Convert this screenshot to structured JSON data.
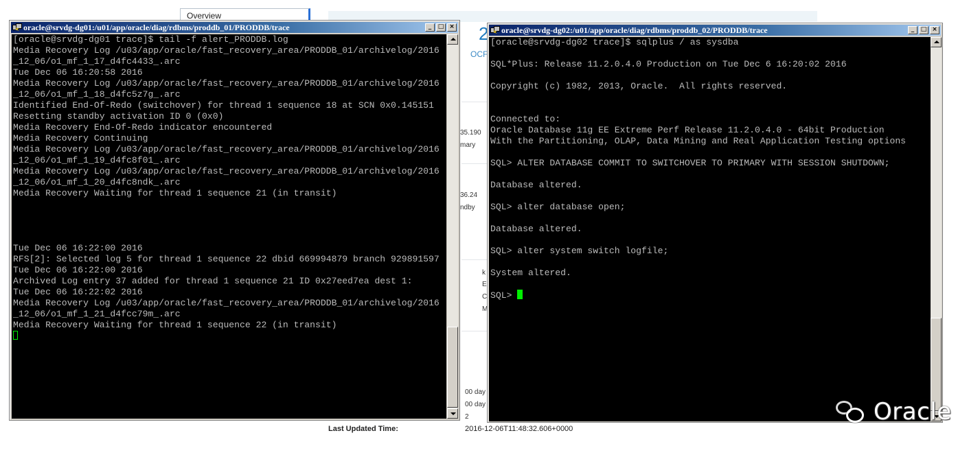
{
  "background": {
    "tab_label": "Overview",
    "big_number": "2",
    "ocp_label": "OCF",
    "fragments": [
      "35.190",
      "mary",
      "36.24",
      "ndby",
      "k",
      "E",
      "C",
      "M",
      "00 day",
      "00 day",
      "2"
    ],
    "last_updated_label": "Last Updated Time:",
    "last_updated_value": "2016-12-06T11:48:32.606+0000"
  },
  "window1": {
    "title": "oracle@srvdg-dg01:/u01/app/oracle/diag/rdbms/proddb_01/PRODDB/trace",
    "controls": [
      "_",
      "□",
      "×"
    ],
    "lines": [
      "[oracle@srvdg-dg01 trace]$ tail -f alert_PRODDB.log",
      "Media Recovery Log /u03/app/oracle/fast_recovery_area/PRODDB_01/archivelog/2016",
      "_12_06/o1_mf_1_17_d4fc4433_.arc",
      "Tue Dec 06 16:20:58 2016",
      "Media Recovery Log /u03/app/oracle/fast_recovery_area/PRODDB_01/archivelog/2016",
      "_12_06/o1_mf_1_18_d4fc5z7g_.arc",
      "Identified End-Of-Redo (switchover) for thread 1 sequence 18 at SCN 0x0.145151",
      "Resetting standby activation ID 0 (0x0)",
      "Media Recovery End-Of-Redo indicator encountered",
      "Media Recovery Continuing",
      "Media Recovery Log /u03/app/oracle/fast_recovery_area/PRODDB_01/archivelog/2016",
      "_12_06/o1_mf_1_19_d4fc8f01_.arc",
      "Media Recovery Log /u03/app/oracle/fast_recovery_area/PRODDB_01/archivelog/2016",
      "_12_06/o1_mf_1_20_d4fc8ndk_.arc",
      "Media Recovery Waiting for thread 1 sequence 21 (in transit)",
      "",
      "",
      "",
      "",
      "Tue Dec 06 16:22:00 2016",
      "RFS[2]: Selected log 5 for thread 1 sequence 22 dbid 669994879 branch 929891597",
      "Tue Dec 06 16:22:00 2016",
      "Archived Log entry 37 added for thread 1 sequence 21 ID 0x27eed7ea dest 1:",
      "Tue Dec 06 16:22:02 2016",
      "Media Recovery Log /u03/app/oracle/fast_recovery_area/PRODDB_01/archivelog/2016",
      "_12_06/o1_mf_1_21_d4fcc79m_.arc",
      "Media Recovery Waiting for thread 1 sequence 22 (in transit)"
    ]
  },
  "window2": {
    "title": "oracle@srvdg-dg02:/u01/app/oracle/diag/rdbms/proddb_02/PRODDB/trace",
    "controls": [
      "_",
      "□",
      "×"
    ],
    "lines": [
      "[oracle@srvdg-dg02 trace]$ sqlplus / as sysdba",
      "",
      "SQL*Plus: Release 11.2.0.4.0 Production on Tue Dec 6 16:20:02 2016",
      "",
      "Copyright (c) 1982, 2013, Oracle.  All rights reserved.",
      "",
      "",
      "Connected to:",
      "Oracle Database 11g EE Extreme Perf Release 11.2.0.4.0 - 64bit Production",
      "With the Partitioning, OLAP, Data Mining and Real Application Testing options",
      "",
      "SQL> ALTER DATABASE COMMIT TO SWITCHOVER TO PRIMARY WITH SESSION SHUTDOWN;",
      "",
      "Database altered.",
      "",
      "SQL> alter database open;",
      "",
      "Database altered.",
      "",
      "SQL> alter system switch logfile;",
      "",
      "System altered.",
      ""
    ],
    "prompt": "SQL> "
  },
  "watermark": {
    "icon": "wechat-icon",
    "text": "Oracle"
  },
  "colors": {
    "terminal_bg": "#000000",
    "terminal_fg": "#bbbbbb",
    "cursor": "#00ee00",
    "title_active": "#0a246a"
  }
}
